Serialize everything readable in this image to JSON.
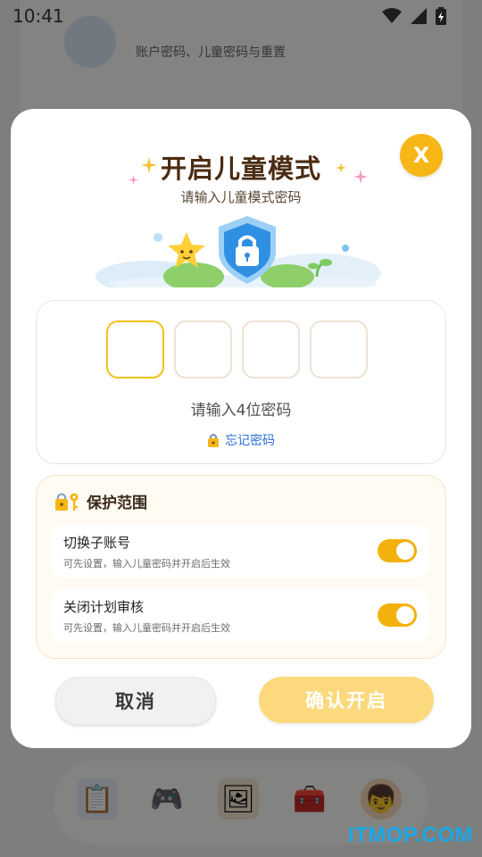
{
  "status_bar": {
    "time": "10:41"
  },
  "background_app": {
    "profile_title": "",
    "profile_subtitle": "账户密码、儿童密码与重置",
    "second_row_title": ""
  },
  "dialog": {
    "title": "开启儿童模式",
    "subtitle": "请输入儿童模式密码",
    "close_label": "X",
    "pin": {
      "length": 4,
      "hint": "请输入4位密码",
      "forgot_label": "忘记密码"
    },
    "protection": {
      "title": "保护范围",
      "items": [
        {
          "title": "切换子账号",
          "description": "可先设置，输入儿童密码并开启后生效",
          "enabled": true
        },
        {
          "title": "关闭计划审核",
          "description": "可先设置，输入儿童密码并开启后生效",
          "enabled": true
        }
      ]
    },
    "cancel_label": "取消",
    "confirm_label": "确认开启"
  },
  "watermark": "ITMOP.COM",
  "colors": {
    "accent": "#f6b616",
    "toggle_on": "#f3b10e",
    "confirm_disabled": "#fcd97c",
    "link": "#2f6fd8"
  }
}
